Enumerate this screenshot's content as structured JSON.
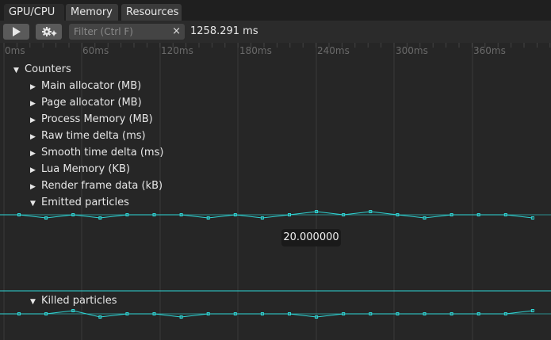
{
  "tabs": [
    {
      "label": "GPU/CPU"
    },
    {
      "label": "Memory"
    },
    {
      "label": "Resources"
    }
  ],
  "toolbar": {
    "filter_placeholder": "Filter (Ctrl F)",
    "clear_glyph": "×",
    "duration": "1258.291 ms"
  },
  "ruler": {
    "labels": [
      "0ms",
      "60ms",
      "120ms",
      "180ms",
      "240ms",
      "300ms",
      "360ms"
    ]
  },
  "tree": {
    "root": "Counters",
    "items": [
      "Main allocator (MB)",
      "Page allocator (MB)",
      "Process Memory (MB)",
      "Raw time delta (ms)",
      "Smooth time delta (ms)",
      "Lua Memory (KB)",
      "Render frame data (kB)",
      "Emitted particles"
    ],
    "killed": "Killed particles"
  },
  "tooltip": {
    "value": "20.000000"
  },
  "colors": {
    "accent": "#2fd6d6",
    "grid": "#3a3a3a"
  },
  "icons": {
    "play": "play-icon",
    "settings": "gear-icon",
    "expanded": "triangle-down-icon",
    "collapsed": "triangle-right-icon"
  },
  "counters": {
    "emitted": [
      0,
      -1,
      0,
      -1,
      0,
      0,
      0,
      -1,
      0,
      -1,
      0,
      1,
      0,
      1,
      0,
      -1,
      0,
      0,
      0,
      -1
    ],
    "killed": [
      0,
      0,
      1,
      -1,
      0,
      0,
      -1,
      0,
      0,
      0,
      0,
      -1,
      0,
      0,
      0,
      0,
      0,
      0,
      0,
      1
    ]
  }
}
